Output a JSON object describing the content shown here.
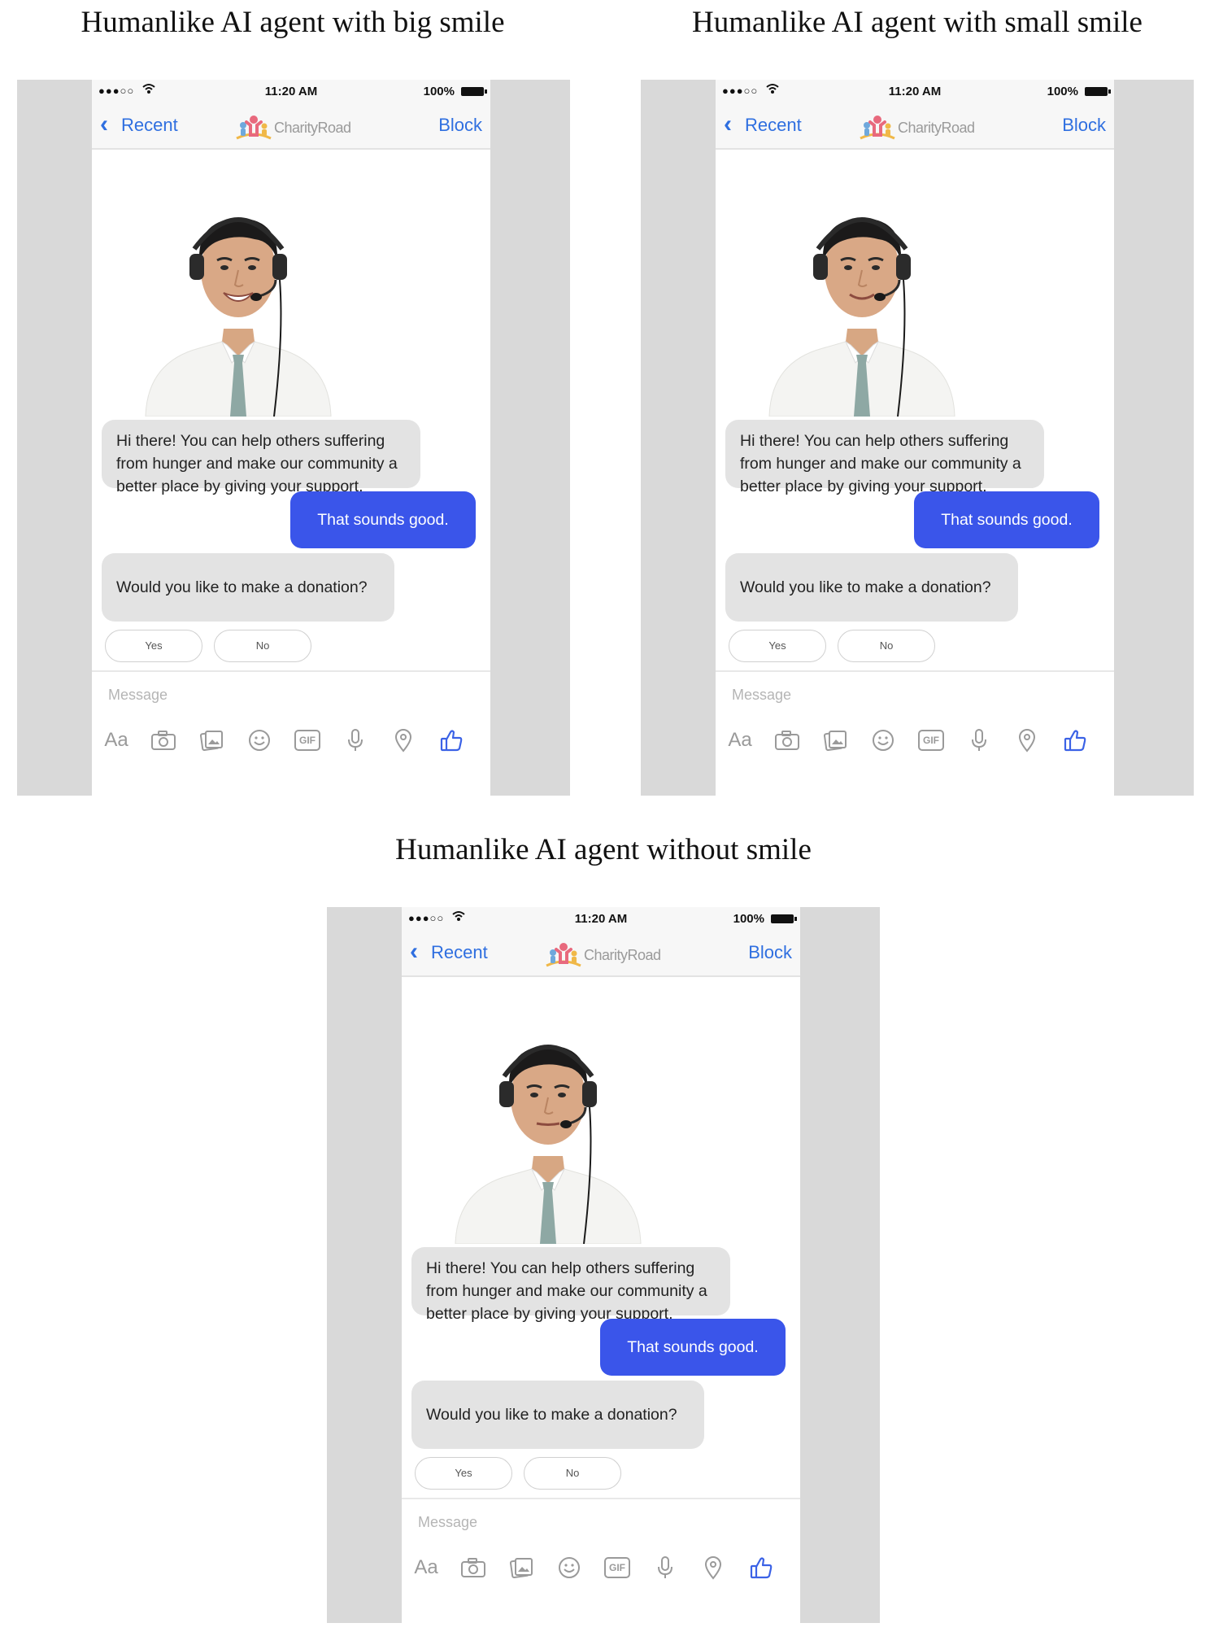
{
  "captions": {
    "top_left": "Humanlike AI agent with big smile",
    "top_right": "Humanlike AI agent with small smile",
    "bottom": "Humanlike AI agent without smile"
  },
  "phone": {
    "status": {
      "signal": "●●●○○",
      "time": "11:20 AM",
      "battery": "100%"
    },
    "nav": {
      "back_label": "Recent",
      "brand": "CharityRoad",
      "right_label": "Block"
    },
    "messages": {
      "bot_intro": "Hi there! You can help others suffering from hunger and make our community a better place by giving your support.",
      "user_reply": "That sounds good.",
      "bot_question": "Would you like to make a donation?"
    },
    "quick_replies": {
      "yes": "Yes",
      "no": "No"
    },
    "composer": {
      "placeholder": "Message",
      "aa_label": "Aa",
      "gif_label": "GIF",
      "icons": [
        "aa-icon",
        "camera-icon",
        "gallery-icon",
        "emoji-icon",
        "gif-icon",
        "microphone-icon",
        "location-icon",
        "thumbs-up-icon"
      ]
    }
  },
  "colors": {
    "accent_blue": "#2f6fe0",
    "user_bubble": "#3a55ea",
    "bot_bubble": "#e3e3e3",
    "panel_bg": "#d9d9d9"
  }
}
